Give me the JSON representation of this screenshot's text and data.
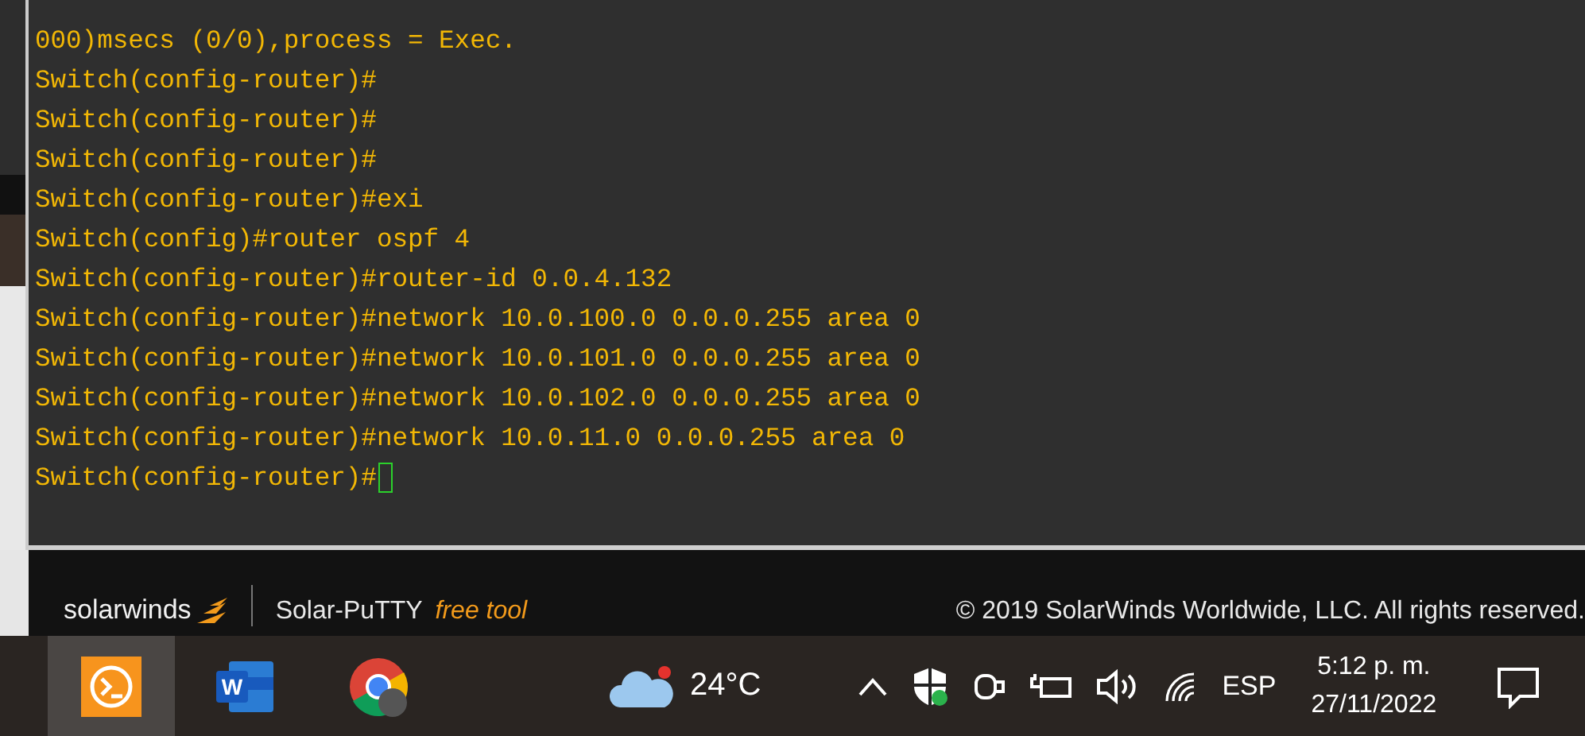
{
  "terminal": {
    "lines": [
      "000)msecs (0/0),process = Exec.",
      "Switch(config-router)#",
      "Switch(config-router)#",
      "Switch(config-router)#",
      "Switch(config-router)#exi",
      "Switch(config)#router ospf 4",
      "Switch(config-router)#router-id 0.0.4.132",
      "Switch(config-router)#network 10.0.100.0 0.0.0.255 area 0",
      "Switch(config-router)#network 10.0.101.0 0.0.0.255 area 0",
      "Switch(config-router)#network 10.0.102.0 0.0.0.255 area 0",
      "Switch(config-router)#network 10.0.11.0 0.0.0.255 area 0",
      "Switch(config-router)#"
    ],
    "cursor": true
  },
  "footer": {
    "brand": "solarwinds",
    "product": "Solar-PuTTY",
    "tag": "free tool",
    "copyright": "© 2019 SolarWinds Worldwide, LLC. All rights reserved."
  },
  "taskbar": {
    "apps": [
      {
        "kind": "putty",
        "selected": true
      },
      {
        "kind": "word",
        "label": "W",
        "selected": false
      },
      {
        "kind": "chrome",
        "selected": false
      }
    ],
    "weather": "24°C",
    "language": "ESP",
    "time": "5:12 p. m.",
    "date": "27/11/2022"
  }
}
